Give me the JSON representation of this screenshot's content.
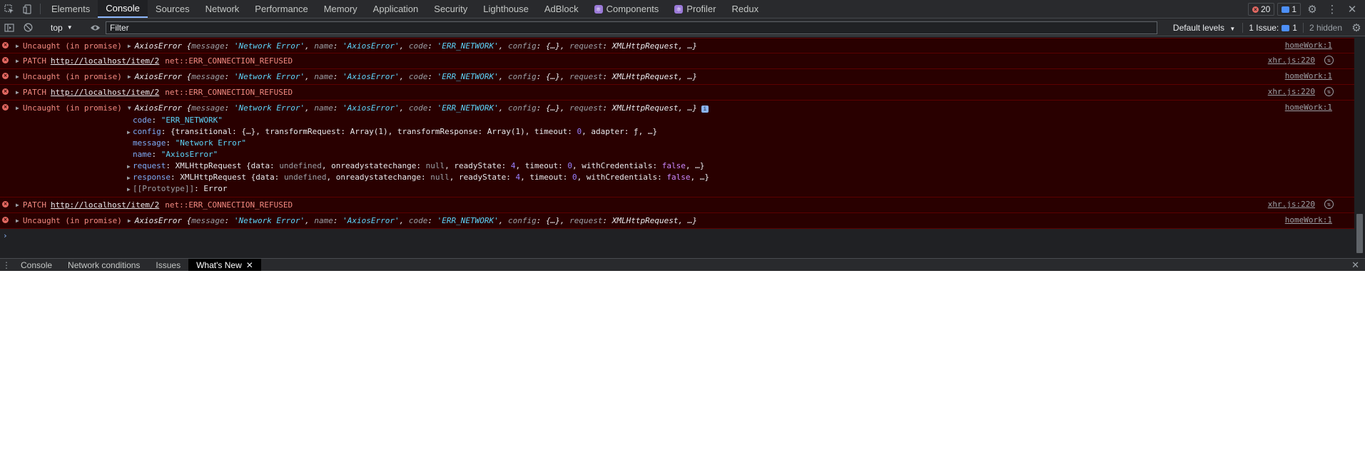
{
  "tabs": [
    "Elements",
    "Console",
    "Sources",
    "Network",
    "Performance",
    "Memory",
    "Application",
    "Security",
    "Lighthouse",
    "AdBlock",
    "Components",
    "Profiler",
    "Redux"
  ],
  "active_tab": "Console",
  "badges": {
    "errors": "20",
    "messages": "1"
  },
  "toolbar": {
    "context": "top",
    "filter_placeholder": "Filter",
    "levels": "Default levels",
    "issues_label": "1 Issue:",
    "issues_count": "1",
    "hidden": "2 hidden"
  },
  "messages": {
    "uncaught": "Uncaught (in promise)",
    "patch": "PATCH",
    "url": "http://localhost/item/2",
    "net_error": "net::ERR_CONNECTION_REFUSED",
    "src_home": "homeWork:1",
    "src_xhr": "xhr.js:220",
    "axios_summary": {
      "class": "AxiosError",
      "message_key": "message",
      "message_val": "'Network Error'",
      "name_key": "name",
      "name_val": "'AxiosError'",
      "code_key": "code",
      "code_val": "'ERR_NETWORK'",
      "config_key": "config",
      "config_val": "{…}",
      "request_key": "request",
      "request_val": "XMLHttpRequest",
      "tail": ", …}"
    },
    "expanded": {
      "code": "\"ERR_NETWORK\"",
      "config_head": "{transitional: {…}, transformRequest: Array(1), transformResponse: Array(1), timeout: ",
      "config_timeout": "0",
      "config_tail": ", adapter: ƒ, …}",
      "message": "\"Network Error\"",
      "name": "\"AxiosError\"",
      "xhr_head": "XMLHttpRequest {data: ",
      "xhr_undef": "undefined",
      "xhr_mid": ", onreadystatechange: ",
      "xhr_null": "null",
      "xhr_rs": ", readyState: ",
      "xhr_rs_val": "4",
      "xhr_to": ", timeout: ",
      "xhr_to_val": "0",
      "xhr_wc": ", withCredentials: ",
      "xhr_false": "false",
      "xhr_tail": ", …}",
      "prototype_key": "[[Prototype]]",
      "prototype_val": "Error"
    }
  },
  "drawer": {
    "tabs": [
      "Console",
      "Network conditions",
      "Issues",
      "What's New"
    ],
    "active": "What's New"
  }
}
